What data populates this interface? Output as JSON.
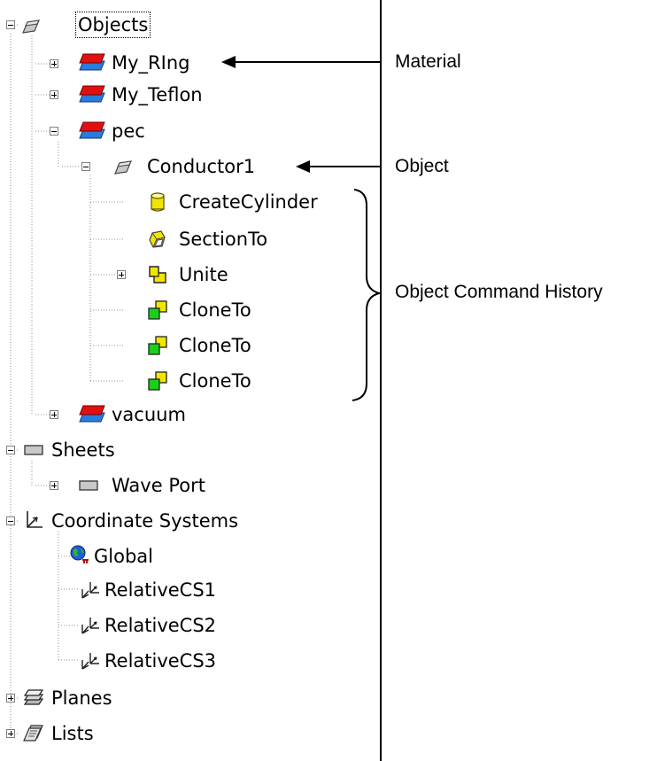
{
  "tree": {
    "objects": {
      "label": "Objects",
      "materials": {
        "ring": {
          "label": "My_RIng"
        },
        "teflon": {
          "label": "My_Teflon"
        },
        "pec": {
          "label": "pec",
          "conductor": {
            "label": "Conductor1",
            "history": [
              "CreateCylinder",
              "SectionTo",
              "Unite",
              "CloneTo",
              "CloneTo",
              "CloneTo"
            ]
          }
        },
        "vacuum": {
          "label": "vacuum"
        }
      }
    },
    "sheets": {
      "label": "Sheets",
      "wave_port": "Wave Port"
    },
    "coordinate_systems": {
      "label": "Coordinate Systems",
      "items": [
        "Global",
        "RelativeCS1",
        "RelativeCS2",
        "RelativeCS3"
      ]
    },
    "planes": {
      "label": "Planes"
    },
    "lists": {
      "label": "Lists"
    }
  },
  "annotations": {
    "material": "Material",
    "object": "Object",
    "history": "Object Command History"
  },
  "colors": {
    "material_top": "#e01010",
    "material_bottom": "#2a7bdc",
    "cylinder_yellow": "#f2e600",
    "clone_green": "#18d018",
    "sheet_gray": "#c8c8c8"
  },
  "icons": {
    "objects": "solid-box-icon",
    "material": "material-stack-icon",
    "conductor": "solid-box-icon",
    "create_cylinder": "cylinder-icon",
    "section_to": "section-icon",
    "unite": "unite-icon",
    "clone_to": "clone-icon",
    "sheets": "sheet-icon",
    "coordinate_systems": "axes-icon",
    "global": "globe-icon",
    "relative_cs": "relative-axes-icon",
    "planes": "planes-icon",
    "lists": "lists-icon"
  }
}
